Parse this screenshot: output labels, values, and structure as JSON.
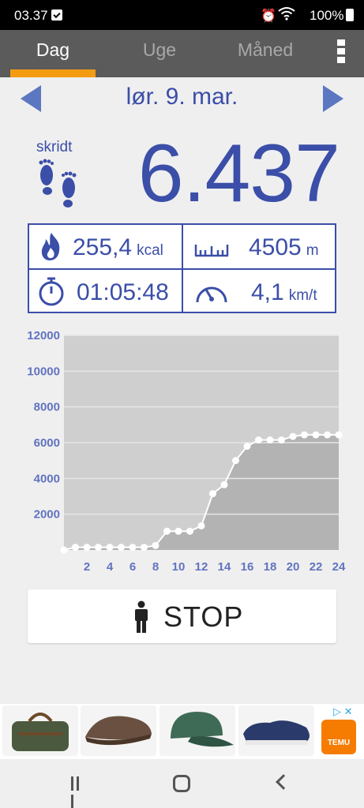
{
  "status_bar": {
    "time": "03.37",
    "battery": "100%"
  },
  "tabs": [
    {
      "label": "Dag",
      "active": true
    },
    {
      "label": "Uge",
      "active": false
    },
    {
      "label": "Måned",
      "active": false
    }
  ],
  "date": {
    "label": "lør. 9. mar."
  },
  "steps": {
    "label": "skridt",
    "value": "6.437"
  },
  "stats": {
    "calories": {
      "value": "255,4",
      "unit": "kcal",
      "icon": "flame-icon"
    },
    "distance": {
      "value": "4505",
      "unit": "m",
      "icon": "ruler-icon"
    },
    "duration": {
      "value": "01:05:48",
      "unit": "",
      "icon": "stopwatch-icon"
    },
    "speed": {
      "value": "4,1",
      "unit": "km/t",
      "icon": "speedometer-icon"
    }
  },
  "chart_data": {
    "type": "area",
    "title": "",
    "xlabel": "",
    "ylabel": "",
    "x": [
      0,
      1,
      2,
      3,
      4,
      5,
      6,
      7,
      8,
      9,
      10,
      11,
      12,
      13,
      14,
      15,
      16,
      17,
      18,
      19,
      20,
      21,
      22,
      23,
      24
    ],
    "values": [
      0,
      150,
      150,
      150,
      150,
      150,
      150,
      150,
      250,
      1050,
      1050,
      1050,
      1350,
      3150,
      3650,
      5000,
      5800,
      6150,
      6150,
      6150,
      6350,
      6437,
      6437,
      6437,
      6437
    ],
    "xticks": [
      "2",
      "4",
      "6",
      "8",
      "10",
      "12",
      "14",
      "16",
      "18",
      "20",
      "22",
      "24"
    ],
    "yticks": [
      "2000",
      "4000",
      "6000",
      "8000",
      "10000",
      "12000"
    ],
    "xlim": [
      0,
      24
    ],
    "ylim": [
      0,
      12000
    ],
    "grid": true,
    "colors": {
      "plot_bg": "#cfcfcf",
      "area": "#b3b3b3",
      "line": "#ffffff",
      "tick_label": "#6173c0"
    }
  },
  "stop_button": {
    "label": "STOP"
  },
  "colors": {
    "accent": "#3b4ea8",
    "tab_indicator": "#f39c12",
    "tabbar_bg": "#5b5b5b"
  }
}
